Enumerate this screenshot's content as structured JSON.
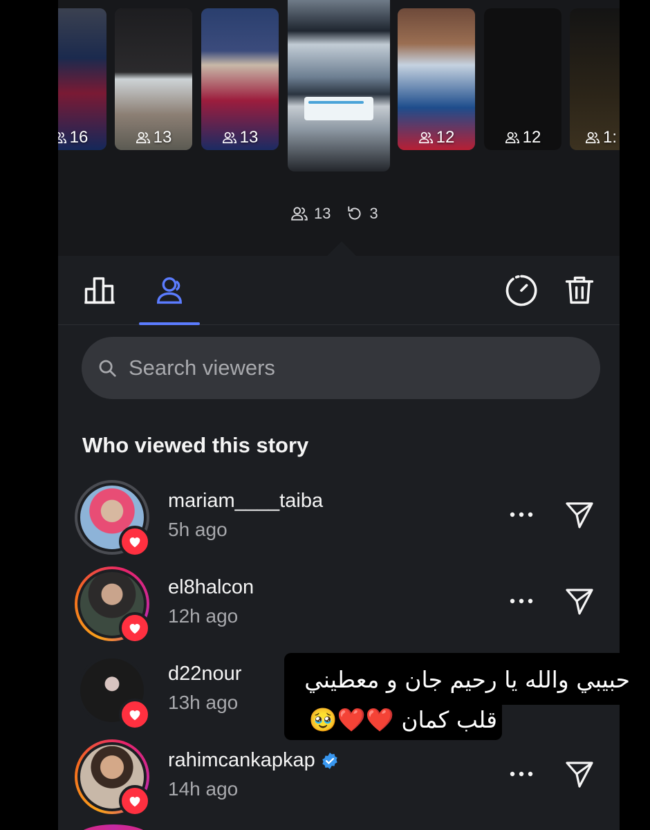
{
  "stories": {
    "thumbnails": [
      {
        "count": "16"
      },
      {
        "count": "13"
      },
      {
        "count": "13"
      },
      {
        "count": "12"
      },
      {
        "count": "12"
      },
      {
        "count": "1:"
      }
    ],
    "selected": {
      "viewers": "13",
      "replays": "3"
    }
  },
  "toolbar": {
    "insights_icon": "bar-chart-icon",
    "viewers_tab_icon": "people-icon",
    "highlight_icon": "dashed-circle-icon",
    "delete_icon": "trash-icon",
    "accent_color": "#5b7cff"
  },
  "search": {
    "placeholder": "Search viewers"
  },
  "section_title": "Who viewed this story",
  "viewers": [
    {
      "username": "mariam____taiba",
      "time": "5h ago",
      "liked": true,
      "verified": false
    },
    {
      "username": "el8halcon",
      "time": "12h ago",
      "liked": true,
      "verified": false
    },
    {
      "username": "d22nour",
      "time": "13h ago",
      "liked": true,
      "verified": false
    },
    {
      "username": "rahimcankapkap",
      "time": "14h ago",
      "liked": true,
      "verified": true
    }
  ],
  "overlay_comment": {
    "line1": "حبيبي والله يا رحيم جان و معطيني",
    "line2": "قلب كمان ❤️❤️🥹"
  },
  "colors": {
    "background": "#1c1e22",
    "heart": "#ff3040",
    "verified": "#3897f0"
  }
}
